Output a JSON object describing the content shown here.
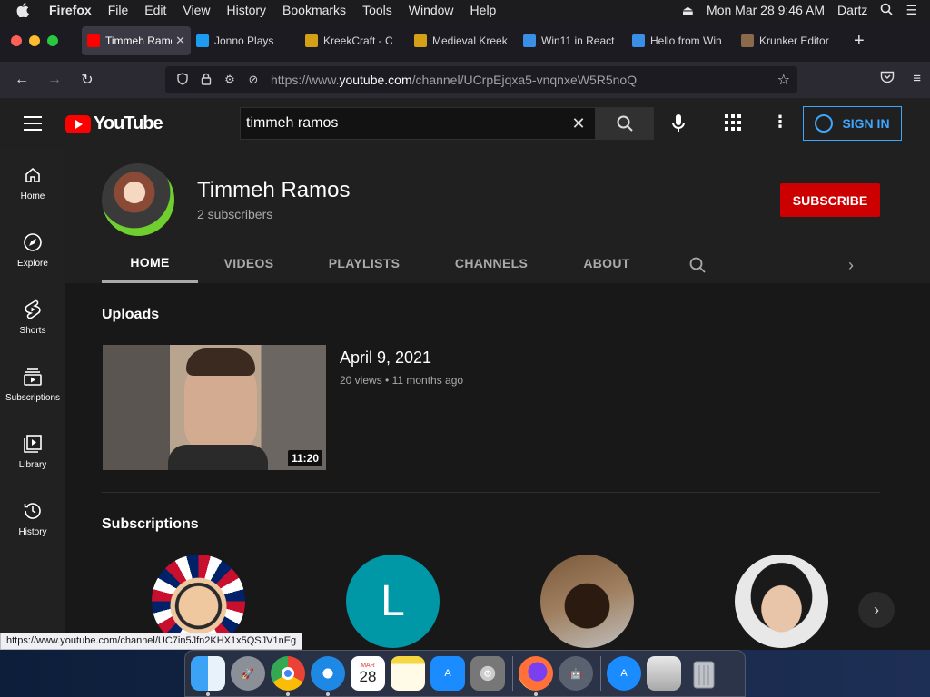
{
  "menubar": {
    "app": "Firefox",
    "items": [
      "File",
      "Edit",
      "View",
      "History",
      "Bookmarks",
      "Tools",
      "Window",
      "Help"
    ],
    "datetime": "Mon Mar 28  9:46 AM",
    "user": "Dartz"
  },
  "tabs": [
    {
      "label": "Timmeh Ramos",
      "color": "#ff0000"
    },
    {
      "label": "Jonno Plays",
      "color": "#1d9bf0"
    },
    {
      "label": "KreekCraft - C",
      "color": "#d4a017"
    },
    {
      "label": "Medieval Kreek",
      "color": "#d4a017"
    },
    {
      "label": "Win11 in React",
      "color": "#3a8ee6"
    },
    {
      "label": "Hello from Win",
      "color": "#3a8ee6"
    },
    {
      "label": "Krunker Editor",
      "color": "#8a6a4a"
    }
  ],
  "navbar": {
    "url_prefix": "https://www.",
    "url_host": "youtube.com",
    "url_path": "/channel/UCrpEjqxa5-vnqnxeW5R5noQ"
  },
  "youtube": {
    "logo_text": "YouTube",
    "search_value": "timmeh ramos",
    "signin_label": "SIGN IN",
    "sidebar": [
      {
        "label": "Home",
        "icon": "home-icon"
      },
      {
        "label": "Explore",
        "icon": "compass-icon"
      },
      {
        "label": "Shorts",
        "icon": "shorts-icon"
      },
      {
        "label": "Subscriptions",
        "icon": "subscriptions-icon"
      },
      {
        "label": "Library",
        "icon": "library-icon"
      },
      {
        "label": "History",
        "icon": "history-icon"
      }
    ],
    "channel": {
      "name": "Timmeh Ramos",
      "subscribers": "2 subscribers",
      "subscribe_label": "SUBSCRIBE",
      "tabs": [
        "HOME",
        "VIDEOS",
        "PLAYLISTS",
        "CHANNELS",
        "ABOUT"
      ]
    },
    "uploads": {
      "title": "Uploads",
      "video": {
        "title": "April 9, 2021",
        "views": "20 views",
        "age": "11 months ago",
        "duration": "11:20"
      }
    },
    "subscriptions": {
      "title": "Subscriptions",
      "letter_avatar": "L"
    }
  },
  "status_link": "https://www.youtube.com/channel/UC7in5Jfn2KHX1x5QSJV1nEg",
  "dock": {
    "calendar_month": "MAR",
    "calendar_day": "28"
  }
}
